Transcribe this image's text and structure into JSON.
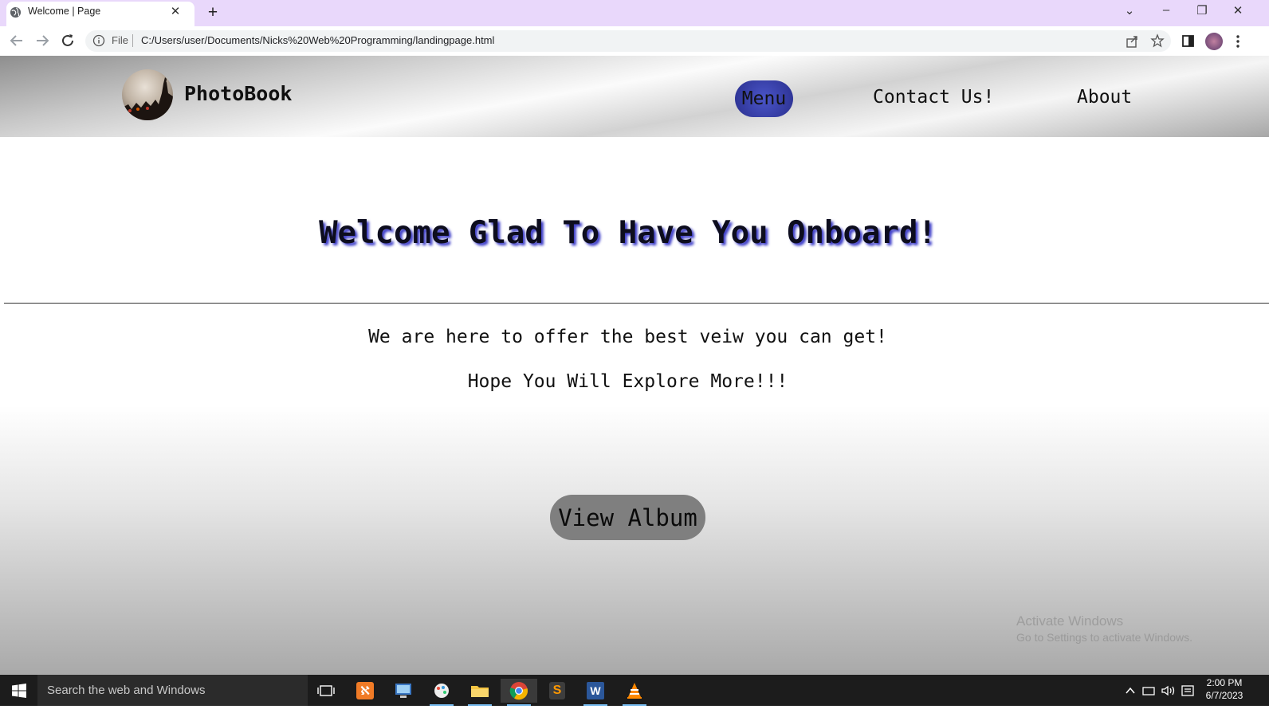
{
  "browser": {
    "tab_title": "Welcome | Page",
    "tab_close": "✕",
    "new_tab": "+",
    "file_label": "File",
    "url": "C:/Users/user/Documents/Nicks%20Web%20Programming/landingpage.html",
    "window_controls": [
      "⌄",
      "–",
      "❐",
      "✕"
    ]
  },
  "site": {
    "name": "PhotoBook",
    "nav": {
      "menu": "Menu",
      "contact": "Contact Us!",
      "about": "About"
    },
    "heading": "Welcome Glad To Have You Onboard!",
    "tagline": "We are here to offer the best veiw you can get!",
    "subtagline": "Hope You Will Explore More!!!",
    "cta": "View Album"
  },
  "watermark": {
    "title": "Activate Windows",
    "text": "Go to Settings to activate Windows."
  },
  "taskbar": {
    "search_placeholder": "Search the web and Windows",
    "time": "2:00 PM",
    "date": "6/7/2023"
  },
  "colors": {
    "tabstrip": "#e9d8fb",
    "menu_pill": "#2a2f8e",
    "heading_shadow": "#3c3cc8",
    "cta_bg": "#7f7f7f"
  }
}
